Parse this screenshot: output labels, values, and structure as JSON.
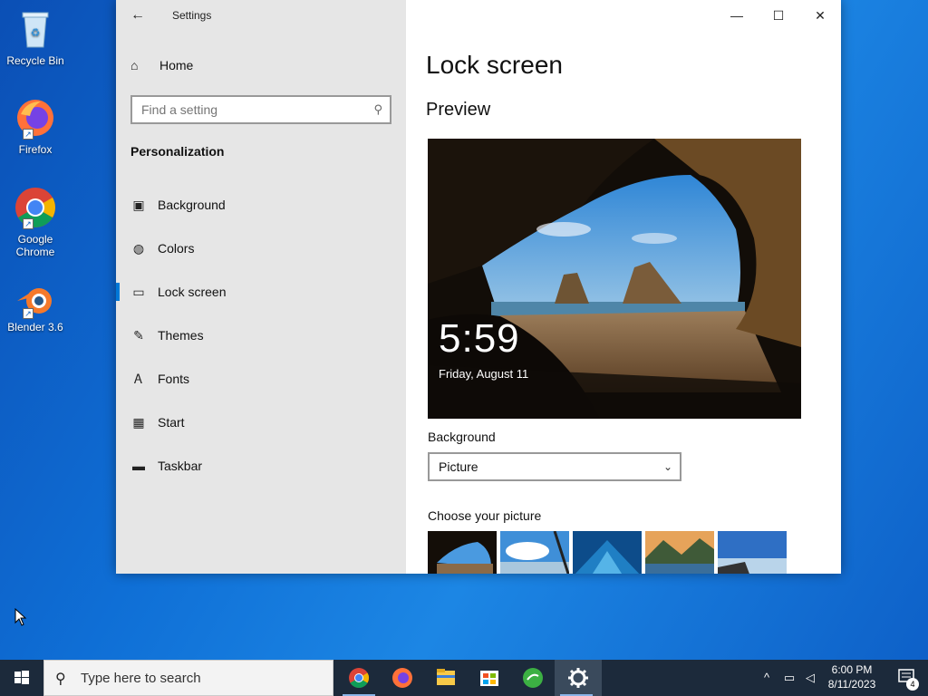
{
  "desktop": {
    "icons": [
      {
        "label": "Recycle Bin"
      },
      {
        "label": "Firefox"
      },
      {
        "label": "Google Chrome"
      },
      {
        "label": "Blender 3.6"
      }
    ]
  },
  "window": {
    "title": "Settings",
    "controls": {
      "minimize": "—",
      "maximize": "☐",
      "close": "✕"
    }
  },
  "sidebar": {
    "home_label": "Home",
    "search_placeholder": "Find a setting",
    "section_title": "Personalization",
    "items": [
      {
        "label": "Background",
        "icon": "image-icon"
      },
      {
        "label": "Colors",
        "icon": "palette-icon"
      },
      {
        "label": "Lock screen",
        "icon": "lock-screen-icon",
        "active": true
      },
      {
        "label": "Themes",
        "icon": "themes-icon"
      },
      {
        "label": "Fonts",
        "icon": "fonts-icon"
      },
      {
        "label": "Start",
        "icon": "start-icon"
      },
      {
        "label": "Taskbar",
        "icon": "taskbar-icon"
      }
    ]
  },
  "content": {
    "page_title": "Lock screen",
    "preview_heading": "Preview",
    "preview_time": "5:59",
    "preview_date": "Friday, August 11",
    "background_label": "Background",
    "background_value": "Picture",
    "choose_label": "Choose your picture"
  },
  "taskbar": {
    "search_placeholder": "Type here to search",
    "apps": [
      "chrome",
      "firefox",
      "file-explorer",
      "microsoft-store",
      "app-green",
      "settings"
    ],
    "clock_time": "6:00 PM",
    "clock_date": "8/11/2023",
    "notification_count": "4"
  },
  "colors": {
    "accent": "#0078d7",
    "taskbar": "#1c2a3b",
    "sidebar": "#e6e6e6"
  }
}
